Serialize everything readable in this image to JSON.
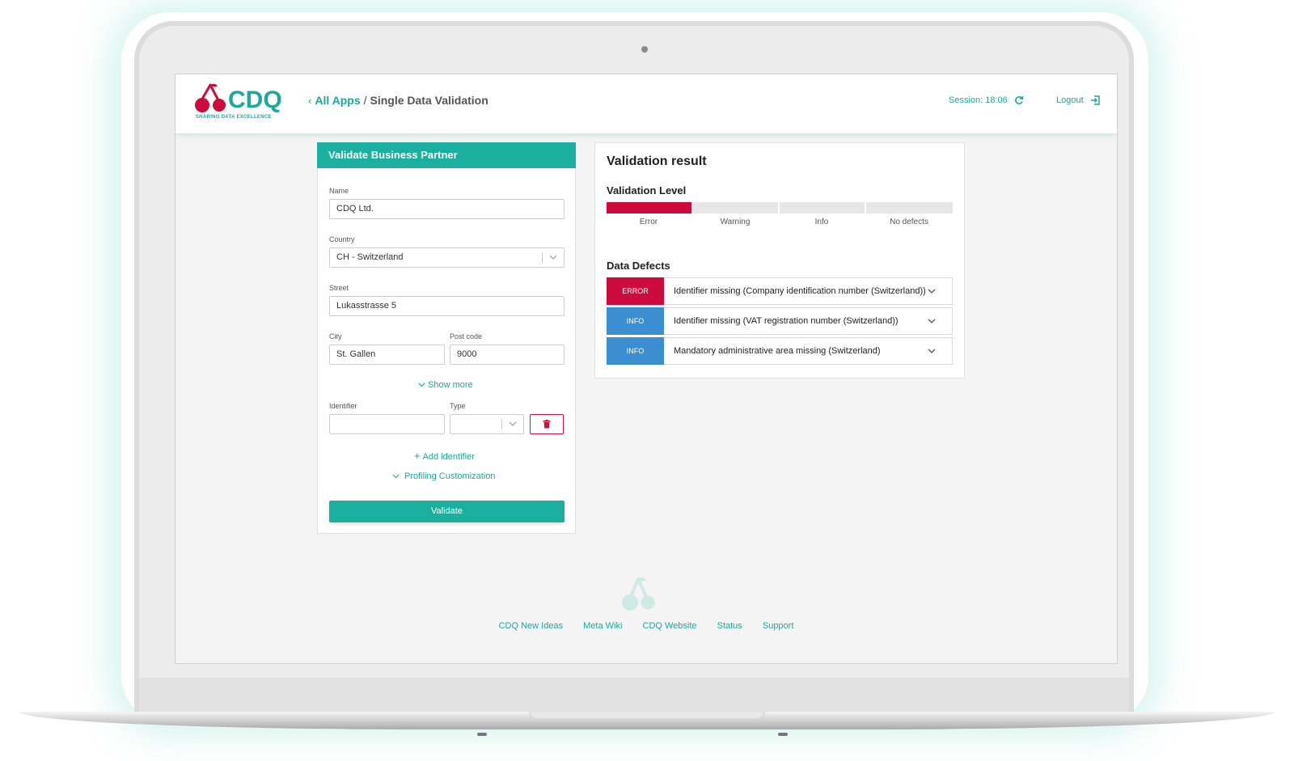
{
  "app": {
    "logo_text": "CDQ",
    "logo_tagline": "SHARING DATA EXCELLENCE",
    "brand_color": "#1aa99a",
    "error_color": "#cc0a3c",
    "info_color": "#3b8fd0"
  },
  "header": {
    "breadcrumb_link": "All Apps",
    "breadcrumb_separator": "/",
    "breadcrumb_current": "Single Data Validation",
    "session_label": "Session: 18:06",
    "session_icon": "refresh-icon",
    "logout_label": "Logout",
    "logout_icon": "logout-icon"
  },
  "form": {
    "title": "Validate Business Partner",
    "name_label": "Name",
    "name_value": "CDQ Ltd.",
    "country_label": "Country",
    "country_value": "CH - Switzerland",
    "street_label": "Street",
    "street_value": "Lukasstrasse 5",
    "city_label": "City",
    "city_value": "St. Gallen",
    "postcode_label": "Post code",
    "postcode_value": "9000",
    "show_more": "Show more",
    "identifier_label": "Identifier",
    "identifier_value": "",
    "type_label": "Type",
    "type_value": "",
    "delete_icon": "trash-icon",
    "add_identifier": "Add identifier",
    "profiling": "Profiling Customization",
    "validate_button": "Validate"
  },
  "result": {
    "title": "Validation result",
    "level_title": "Validation Level",
    "levels": [
      {
        "label": "Error",
        "active": true
      },
      {
        "label": "Warning",
        "active": false
      },
      {
        "label": "Info",
        "active": false
      },
      {
        "label": "No defects",
        "active": false
      }
    ],
    "defects_title": "Data Defects",
    "defects": [
      {
        "severity": "ERROR",
        "text": "Identifier missing (Company identification number (Switzerland))"
      },
      {
        "severity": "INFO",
        "text": "Identifier missing (VAT registration number (Switzerland))"
      },
      {
        "severity": "INFO",
        "text": "Mandatory administrative area missing (Switzerland)"
      }
    ]
  },
  "footer": {
    "links": [
      "CDQ New Ideas",
      "Meta Wiki",
      "CDQ Website",
      "Status",
      "Support"
    ]
  }
}
